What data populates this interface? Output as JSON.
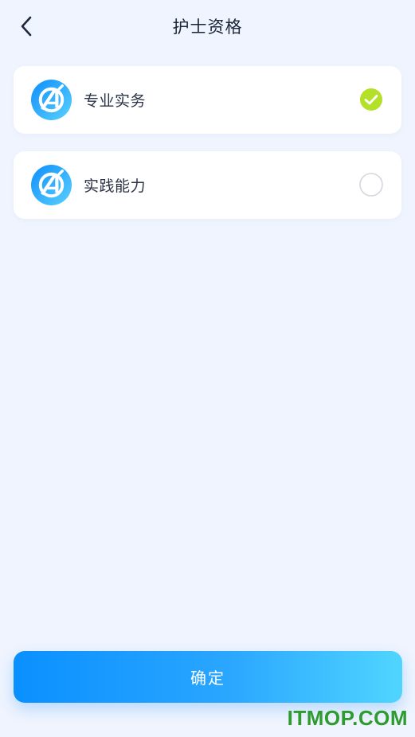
{
  "header": {
    "title": "护士资格",
    "back_icon": "chevron-left-icon"
  },
  "options": [
    {
      "label": "专业实务",
      "selected": true,
      "icon": "app-logo-icon"
    },
    {
      "label": "实践能力",
      "selected": false,
      "icon": "app-logo-icon"
    }
  ],
  "footer": {
    "confirm_label": "确定"
  },
  "watermark": "ITMOP.COM",
  "colors": {
    "background": "#eff4fe",
    "selected_check": "#b5e02a",
    "accent_start": "#0a90ff",
    "accent_end": "#50d5ff",
    "watermark": "#2e9b2e"
  }
}
